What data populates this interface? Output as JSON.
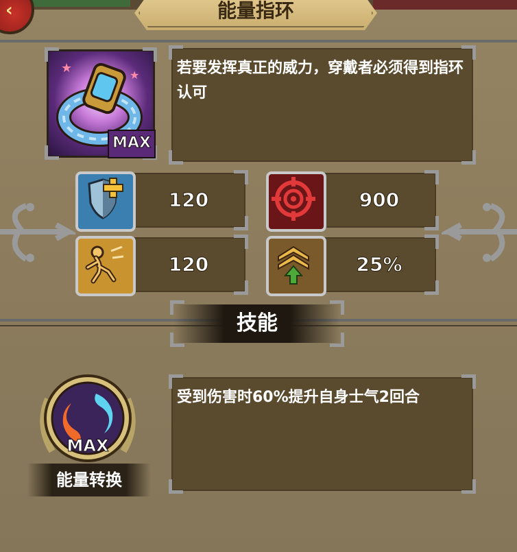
{
  "header": {
    "title": "能量指环",
    "back_icon": "chevron-left-icon"
  },
  "item": {
    "level_badge": "MAX",
    "description": "若要发挥真正的威力，穿戴者必须得到指环认可",
    "icon": "energy-ring-icon"
  },
  "stats": [
    {
      "icon": "shield-plus-icon",
      "value": "120"
    },
    {
      "icon": "target-crosshair-icon",
      "value": "900"
    },
    {
      "icon": "speed-figure-icon",
      "value": "120"
    },
    {
      "icon": "rank-up-arrow-icon",
      "value": "25%"
    }
  ],
  "skill": {
    "section_title": "技能",
    "level_badge": "MAX",
    "name": "能量转换",
    "description": "受到伤害时60%提升自身士气2回合",
    "icon": "yin-yang-energy-icon"
  },
  "colors": {
    "panel": "#8c7c5d",
    "box": "#5a4a2e",
    "frame": "#9a9a9a",
    "title_plate": "#d6bd80"
  }
}
